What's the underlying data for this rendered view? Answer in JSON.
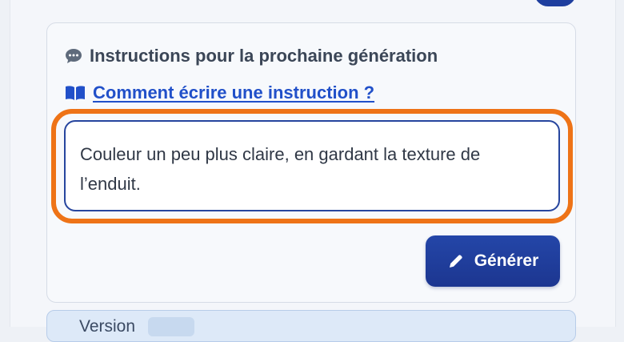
{
  "instructions": {
    "title": "Instructions pour la prochaine génération",
    "help_link": "Comment écrire une instruction ?",
    "textarea_value": "Couleur un peu plus claire, en gardant la texture de l’enduit.",
    "generate_label": "Générer"
  },
  "info_box": {
    "lead": "Version",
    "chip": "",
    "tail": ""
  },
  "colors": {
    "accent": "#ee7317",
    "primary": "#1f3f9f",
    "link": "#2150c9"
  },
  "icons": {
    "heading": "speech-bubble-icon",
    "help": "open-book-icon",
    "button": "pen-icon"
  }
}
